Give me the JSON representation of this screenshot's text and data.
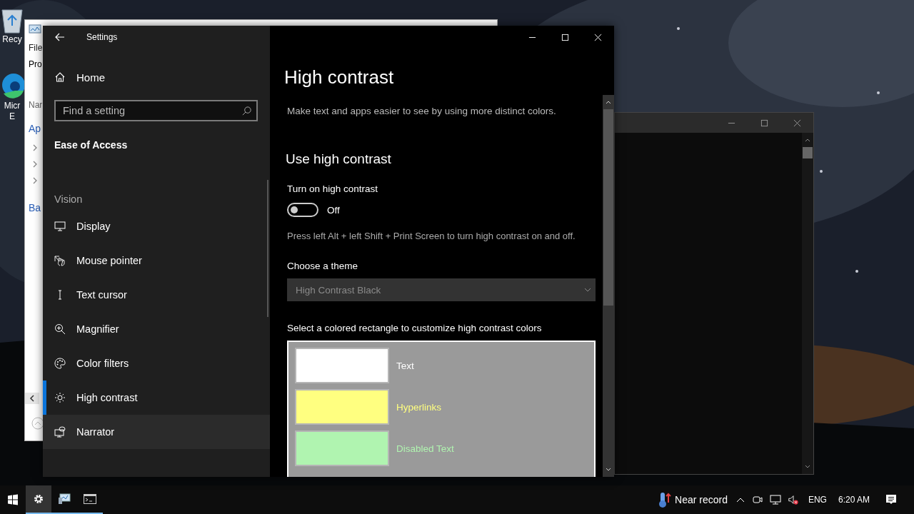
{
  "desktop_icons": [
    {
      "kind": "recycle-bin",
      "lines": [
        "Recy"
      ]
    },
    {
      "kind": "browser",
      "lines": [
        "Micr",
        "E"
      ]
    }
  ],
  "explorer_window": {
    "menu_text": "File",
    "ribbon_text": "Pro",
    "header_text": "Nar",
    "group_text": "Ap",
    "expanders": [
      {
        "expanded": false
      },
      {
        "expanded": false
      },
      {
        "expanded": false
      }
    ],
    "link_text": "Ba"
  },
  "settings_window": {
    "title": "Settings",
    "home": "Home",
    "search": {
      "placeholder": "Find a setting"
    },
    "section": "Ease of Access",
    "group": "Vision",
    "nav_items": [
      {
        "kind": "display",
        "label": "Display",
        "selected": false,
        "hovered": false
      },
      {
        "kind": "pointer",
        "label": "Mouse pointer",
        "selected": false,
        "hovered": false
      },
      {
        "kind": "text-cursor",
        "label": "Text cursor",
        "selected": false,
        "hovered": false
      },
      {
        "kind": "magnifier",
        "label": "Magnifier",
        "selected": false,
        "hovered": false
      },
      {
        "kind": "palette",
        "label": "Color filters",
        "selected": false,
        "hovered": false
      },
      {
        "kind": "sun",
        "label": "High contrast",
        "selected": true,
        "hovered": false
      },
      {
        "kind": "narrator",
        "label": "Narrator",
        "selected": false,
        "hovered": true
      }
    ],
    "content": {
      "heading": "High contrast",
      "description": "Make text and apps easier to see by using more distinct colors.",
      "subheading": "Use high contrast",
      "toggle": {
        "label": "Turn on high contrast",
        "on": false,
        "state_text": "Off"
      },
      "hint": "Press left Alt + left Shift + Print Screen to turn high contrast on and off.",
      "theme": {
        "label": "Choose a theme",
        "value": "High Contrast Black",
        "disabled": true
      },
      "colors_label": "Select a colored rectangle to customize high contrast colors",
      "colors": [
        {
          "label": "Text",
          "color": "#ffffff"
        },
        {
          "label": "Hyperlinks",
          "color": "#ffff80"
        },
        {
          "label": "Disabled Text",
          "color": "#b0f4b0"
        }
      ]
    }
  },
  "taskbar": {
    "apps": [
      {
        "kind": "settings",
        "selected": true
      },
      {
        "kind": "monitor",
        "selected": false
      },
      {
        "kind": "terminal",
        "selected": false
      }
    ],
    "weather": "Near record",
    "volume_muted": true,
    "language": "ENG",
    "time": "6:20 AM"
  }
}
